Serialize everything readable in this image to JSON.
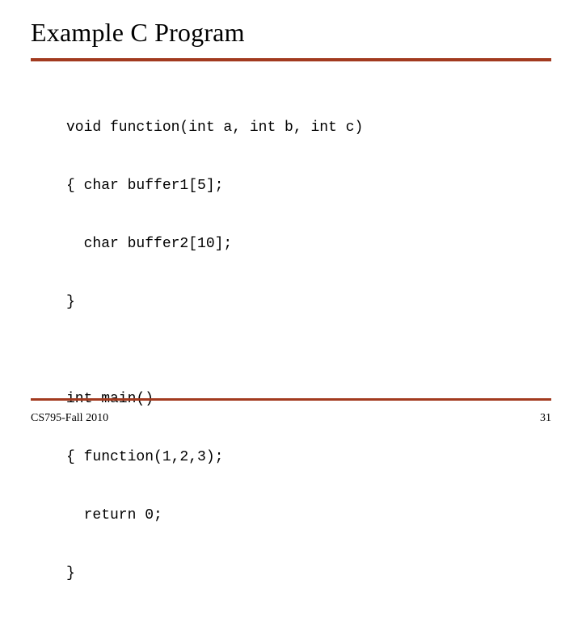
{
  "title": "Example C Program",
  "code_lines": [
    "void function(int a, int b, int c)",
    "{ char buffer1[5];",
    "  char buffer2[10];",
    "}",
    "",
    "int main()",
    "{ function(1,2,3);",
    "  return 0;",
    "}"
  ],
  "footer": {
    "left": "CS795-Fall 2010",
    "right": "31"
  }
}
